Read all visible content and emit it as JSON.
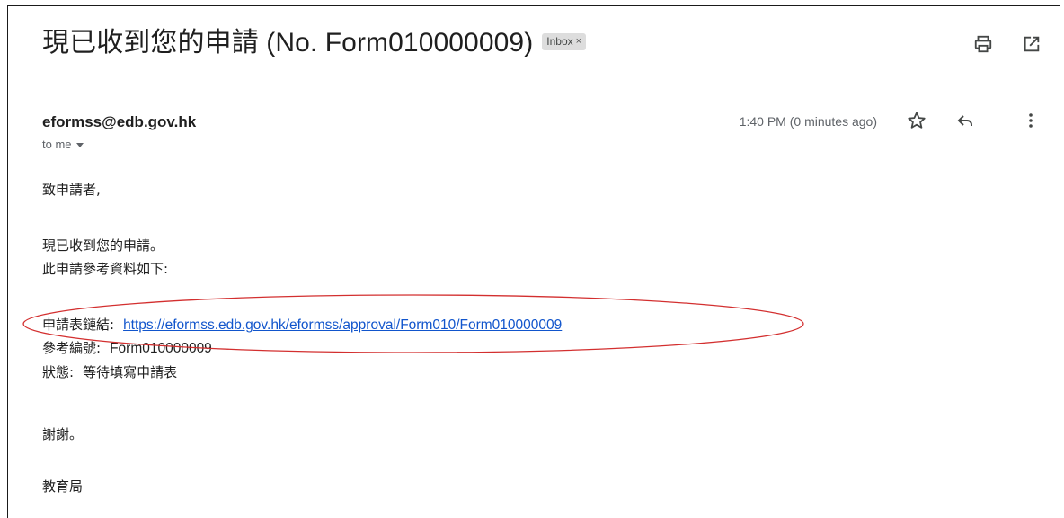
{
  "email": {
    "subject": "現已收到您的申請 (No. Form010000009)",
    "label_chip": "Inbox",
    "label_chip_close": "×",
    "sender": "eformss@edb.gov.hk",
    "recipient": "to me",
    "timestamp": "1:40 PM (0 minutes ago)"
  },
  "body": {
    "greeting": "致申請者,",
    "line1": "現已收到您的申請。",
    "line2": "此申請參考資料如下:",
    "link_label": "申請表鏈結:",
    "link_url": "https://eformss.edb.gov.hk/eformss/approval/Form010/Form010000009",
    "ref_label": "參考編號:",
    "ref_value": "Form010000009",
    "status_label": "狀態:",
    "status_value": "等待填寫申請表",
    "thanks": "謝謝。",
    "signature": "教育局"
  },
  "icons": {
    "print": "print-icon",
    "open_new_window": "open-in-new-window-icon",
    "star": "star-icon",
    "reply": "reply-icon",
    "more": "more-vertical-icon",
    "dropdown": "chevron-down-icon"
  },
  "colors": {
    "link": "#1155cc",
    "annotation": "#d32f2f",
    "chip_bg": "#dddddd"
  }
}
